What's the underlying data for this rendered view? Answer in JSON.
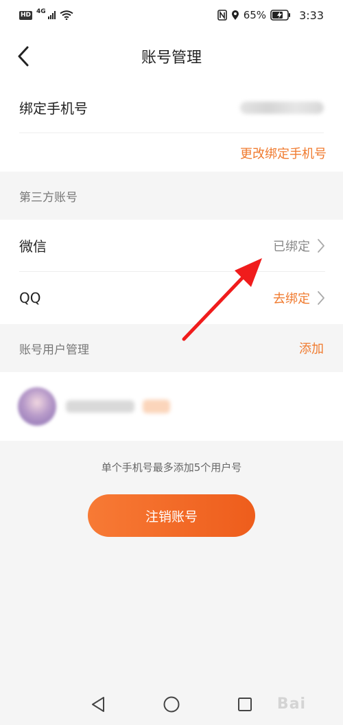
{
  "status_bar": {
    "hd": "HD",
    "network": "4G",
    "battery_percent": "65%",
    "time": "3:33"
  },
  "header": {
    "title": "账号管理",
    "back_icon": "chevron-left-icon"
  },
  "phone": {
    "label": "绑定手机号",
    "change_link": "更改绑定手机号"
  },
  "third_party": {
    "section_title": "第三方账号",
    "items": [
      {
        "label": "微信",
        "status": "已绑定",
        "bound": true
      },
      {
        "label": "QQ",
        "status": "去绑定",
        "bound": false
      }
    ]
  },
  "users": {
    "section_title": "账号用户管理",
    "add_label": "添加"
  },
  "limit_note": "单个手机号最多添加5个用户号",
  "logout_label": "注销账号",
  "colors": {
    "accent": "#f07a2e",
    "button_start": "#f77a35",
    "button_end": "#ee5d1c",
    "annotation": "#f01c1c"
  },
  "watermark": "Bai"
}
